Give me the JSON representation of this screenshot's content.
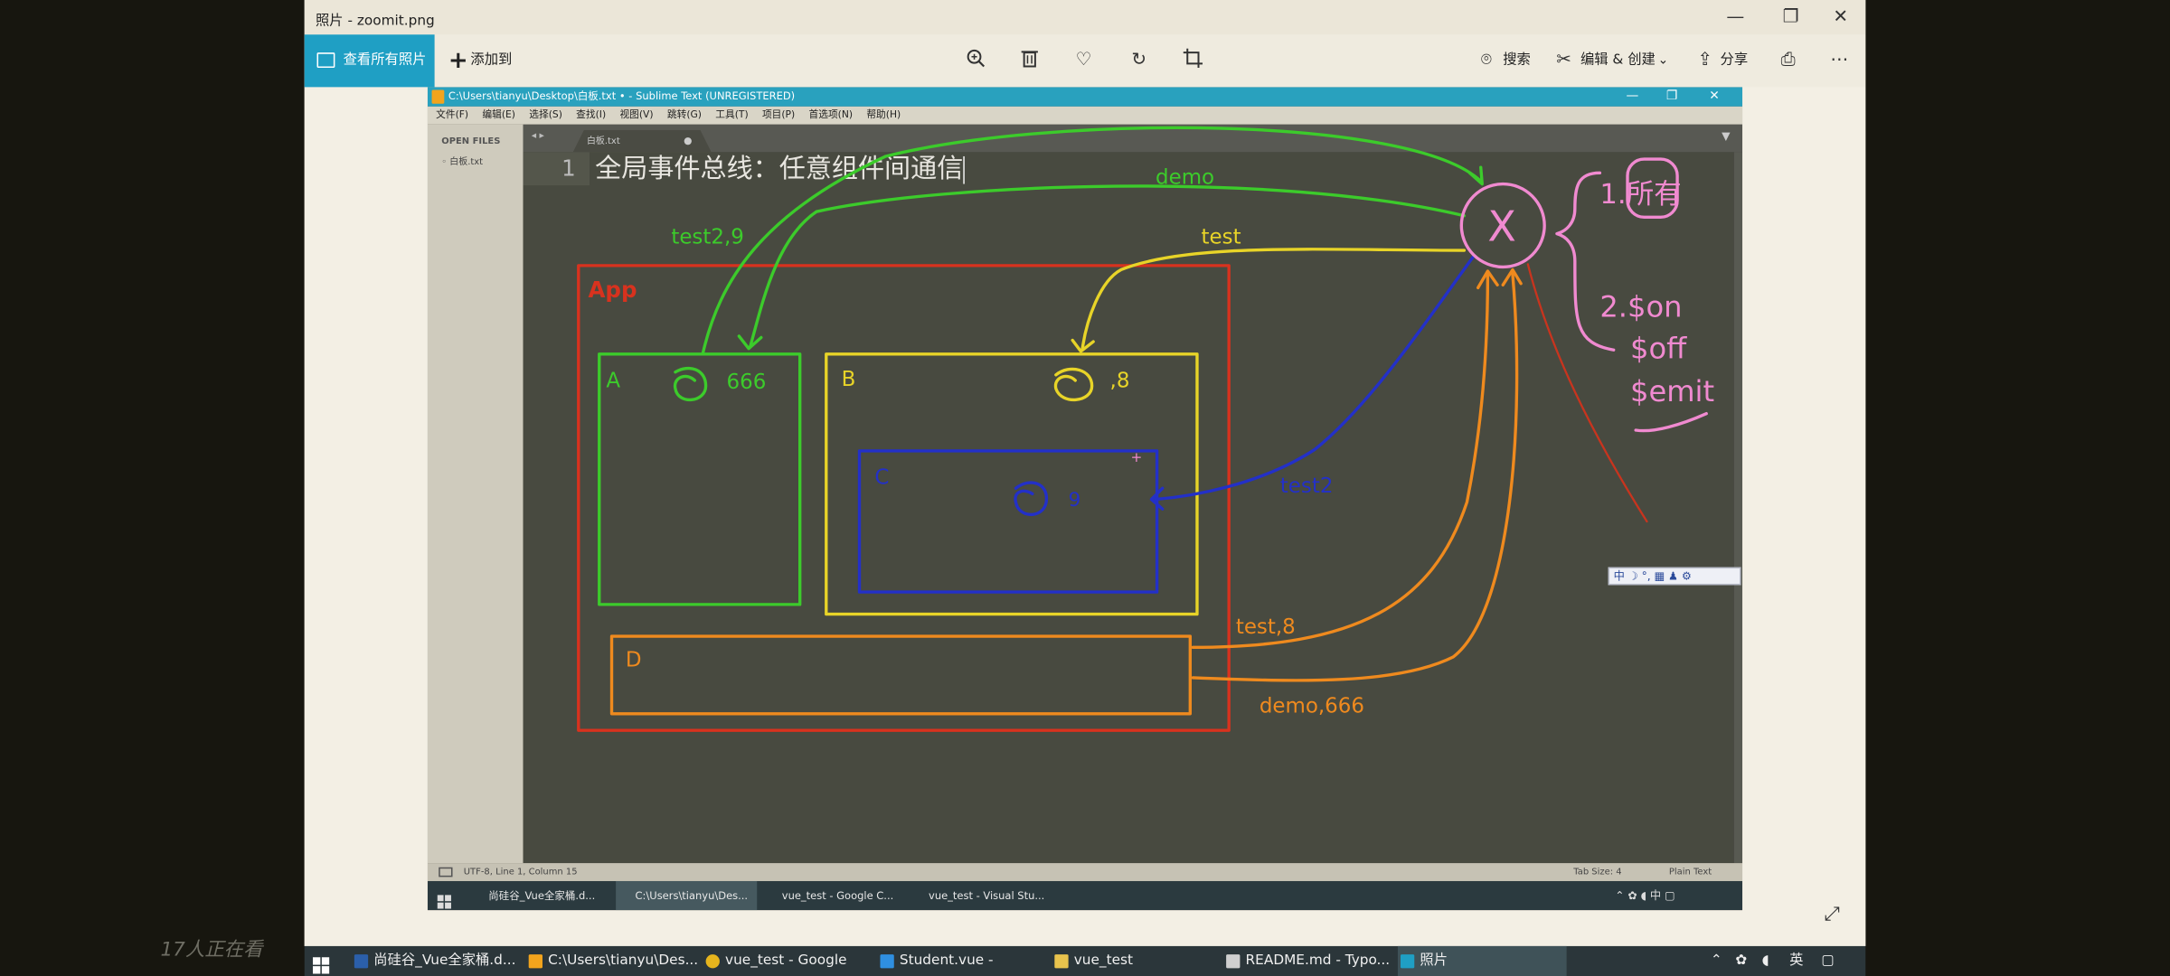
{
  "photos_app": {
    "title": "照片 - zoomit.png",
    "toolbar": {
      "view_all": "查看所有照片",
      "add_to": "添加到",
      "search": "搜索",
      "edit_create": "编辑 & 创建",
      "share": "分享",
      "icons": [
        "zoom-icon",
        "delete-icon",
        "heart-icon",
        "rotate-icon",
        "crop-icon",
        "print-icon",
        "more-icon"
      ]
    }
  },
  "sublime": {
    "title": "C:\\Users\\tianyu\\Desktop\\白板.txt • - Sublime Text (UNREGISTERED)",
    "menu": [
      "文件(F)",
      "编辑(E)",
      "选择(S)",
      "查找(I)",
      "视图(V)",
      "跳转(G)",
      "工具(T)",
      "项目(P)",
      "首选项(N)",
      "帮助(H)"
    ],
    "open_files_label": "OPEN FILES",
    "file": "白板.txt",
    "tab": "白板.txt",
    "line_number": "1",
    "line_text": "全局事件总线：任意组件间通信",
    "status_left": "UTF-8, Line 1, Column 15",
    "status_tab": "Tab Size: 4",
    "status_syntax": "Plain Text",
    "inner_taskbar": [
      "尚硅谷_Vue全家桶.d...",
      "C:\\Users\\tianyu\\Des...",
      "vue_test - Google C...",
      "vue_test - Visual Stu..."
    ],
    "ime": "中 ☽ °, ▦ ♟ ⚙"
  },
  "annotations": {
    "app_label": "App",
    "a_label": "A",
    "a_value": "666",
    "b_label": "B",
    "b_value": ",8",
    "c_label": "C",
    "c_value": "9",
    "d_label": "D",
    "x_label": "X",
    "green_demo": "demo",
    "green_test2_9": "test2,9",
    "yellow_test": "test",
    "blue_test2": "test2",
    "orange_test8": "test,8",
    "orange_demo666": "demo,666",
    "pink_note1": "1.所有",
    "pink_on": "2.$on",
    "pink_off": "$off",
    "pink_emit": "$emit",
    "colors": {
      "red": "#d8321e",
      "green": "#3ccb2b",
      "yellow": "#e8d428",
      "blue": "#2330c8",
      "orange": "#ef8a1e",
      "pink": "#f08ad0"
    }
  },
  "taskbar": {
    "items": [
      "尚硅谷_Vue全家桶.d...",
      "C:\\Users\\tianyu\\Des...",
      "vue_test - Google C...",
      "Student.vue - vue_t...",
      "vue_test",
      "README.md - Typo...",
      "照片"
    ],
    "tray_lang": "英"
  },
  "watermark": "17人正在看"
}
